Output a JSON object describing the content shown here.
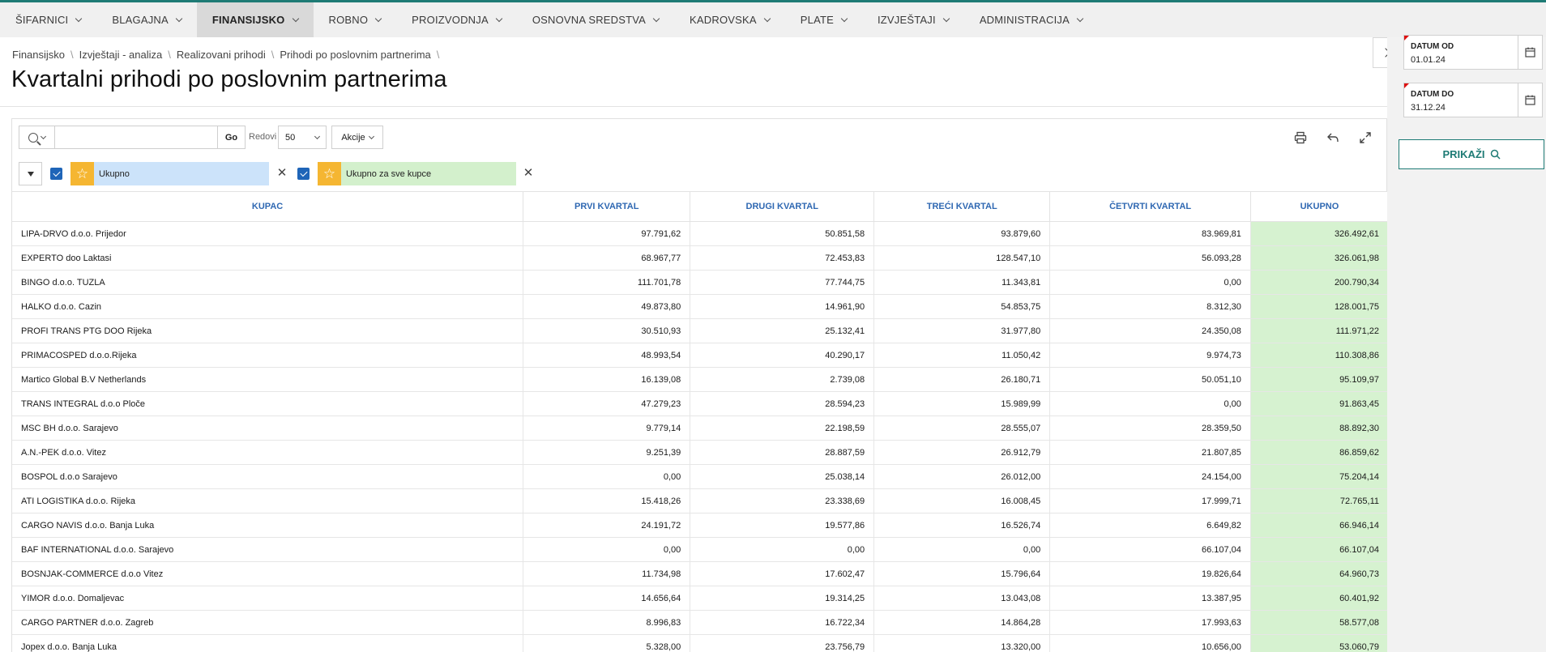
{
  "nav": {
    "items": [
      {
        "label": "ŠIFARNICI",
        "active": false
      },
      {
        "label": "BLAGAJNA",
        "active": false
      },
      {
        "label": "FINANSIJSKO",
        "active": true
      },
      {
        "label": "ROBNO",
        "active": false
      },
      {
        "label": "PROIZVODNJA",
        "active": false
      },
      {
        "label": "OSNOVNA SREDSTVA",
        "active": false
      },
      {
        "label": "KADROVSKA",
        "active": false
      },
      {
        "label": "PLATE",
        "active": false
      },
      {
        "label": "IZVJEŠTAJI",
        "active": false
      },
      {
        "label": "ADMINISTRACIJA",
        "active": false
      }
    ]
  },
  "breadcrumb": [
    "Finansijsko",
    "Izvještaji - analiza",
    "Realizovani prihodi",
    "Prihodi po poslovnim partnerima"
  ],
  "page": {
    "title": "Kvartalni prihodi po poslovnim partnerima"
  },
  "toolbar": {
    "search_value": "",
    "go_label": "Go",
    "rows_label": "Redovi",
    "rows_value": "50",
    "actions_label": "Akcije"
  },
  "filters": [
    {
      "label": "Ukupno",
      "color": "#cce3fa"
    },
    {
      "label": "Ukupno za sve kupce",
      "color": "#d3f0cc"
    }
  ],
  "table": {
    "headers": [
      "KUPAC",
      "PRVI KVARTAL",
      "DRUGI KVARTAL",
      "TREĆI KVARTAL",
      "ČETVRTI KVARTAL",
      "UKUPNO"
    ],
    "rows": [
      [
        "LIPA-DRVO d.o.o. Prijedor",
        "97.791,62",
        "50.851,58",
        "93.879,60",
        "83.969,81",
        "326.492,61"
      ],
      [
        "EXPERTO doo Laktasi",
        "68.967,77",
        "72.453,83",
        "128.547,10",
        "56.093,28",
        "326.061,98"
      ],
      [
        "BINGO d.o.o. TUZLA",
        "111.701,78",
        "77.744,75",
        "11.343,81",
        "0,00",
        "200.790,34"
      ],
      [
        "HALKO d.o.o. Cazin",
        "49.873,80",
        "14.961,90",
        "54.853,75",
        "8.312,30",
        "128.001,75"
      ],
      [
        "PROFI TRANS PTG DOO Rijeka",
        "30.510,93",
        "25.132,41",
        "31.977,80",
        "24.350,08",
        "111.971,22"
      ],
      [
        "PRIMACOSPED d.o.o.Rijeka",
        "48.993,54",
        "40.290,17",
        "11.050,42",
        "9.974,73",
        "110.308,86"
      ],
      [
        "Martico Global B.V Netherlands",
        "16.139,08",
        "2.739,08",
        "26.180,71",
        "50.051,10",
        "95.109,97"
      ],
      [
        "TRANS INTEGRAL d.o.o Ploče",
        "47.279,23",
        "28.594,23",
        "15.989,99",
        "0,00",
        "91.863,45"
      ],
      [
        "MSC BH d.o.o. Sarajevo",
        "9.779,14",
        "22.198,59",
        "28.555,07",
        "28.359,50",
        "88.892,30"
      ],
      [
        "A.N.-PEK d.o.o. Vitez",
        "9.251,39",
        "28.887,59",
        "26.912,79",
        "21.807,85",
        "86.859,62"
      ],
      [
        "BOSPOL d.o.o Sarajevo",
        "0,00",
        "25.038,14",
        "26.012,00",
        "24.154,00",
        "75.204,14"
      ],
      [
        "ATI LOGISTIKA d.o.o. Rijeka",
        "15.418,26",
        "23.338,69",
        "16.008,45",
        "17.999,71",
        "72.765,11"
      ],
      [
        "CARGO NAVIS d.o.o. Banja Luka",
        "24.191,72",
        "19.577,86",
        "16.526,74",
        "6.649,82",
        "66.946,14"
      ],
      [
        "BAF INTERNATIONAL d.o.o. Sarajevo",
        "0,00",
        "0,00",
        "0,00",
        "66.107,04",
        "66.107,04"
      ],
      [
        "BOSNJAK-COMMERCE d.o.o Vitez",
        "11.734,98",
        "17.602,47",
        "15.796,64",
        "19.826,64",
        "64.960,73"
      ],
      [
        "YIMOR d.o.o. Domaljevac",
        "14.656,64",
        "19.314,25",
        "13.043,08",
        "13.387,95",
        "60.401,92"
      ],
      [
        "CARGO PARTNER d.o.o. Zagreb",
        "8.996,83",
        "16.722,34",
        "14.864,28",
        "17.993,63",
        "58.577,08"
      ],
      [
        "Jopex d.o.o. Banja Luka",
        "5.328,00",
        "23.756,79",
        "13.320,00",
        "10.656,00",
        "53.060,79"
      ]
    ]
  },
  "side": {
    "date_from_label": "DATUM OD",
    "date_from_value": "01.01.24",
    "date_to_label": "DATUM DO",
    "date_to_value": "31.12.24",
    "show_label": "PRIKAŽI"
  },
  "colors": {
    "accent": "#1e7b75",
    "header_text": "#2f68b2",
    "total_cell": "#d6f2d0",
    "star": "#f5b632"
  }
}
